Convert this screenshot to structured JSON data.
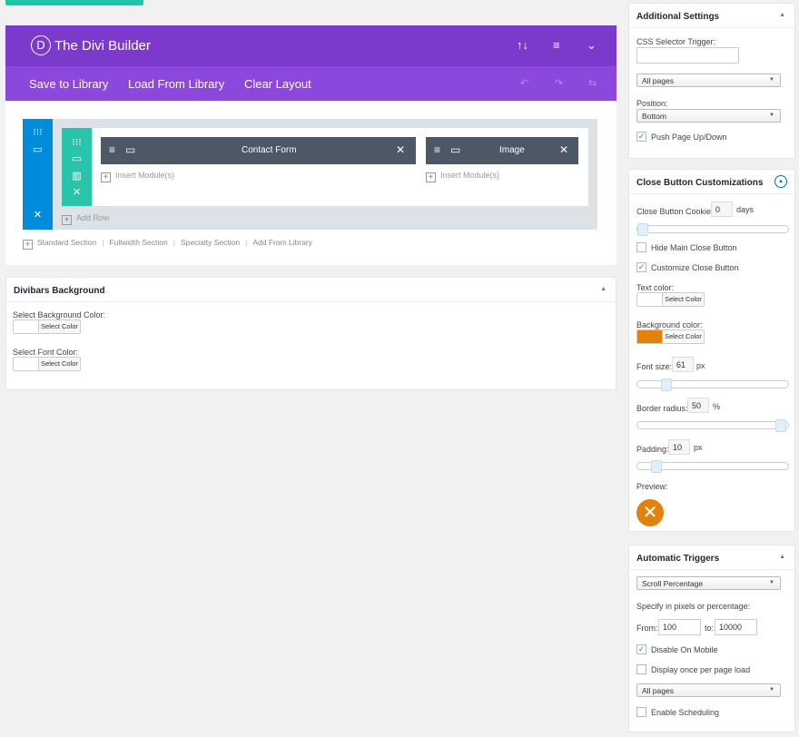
{
  "builder": {
    "logo_letter": "D",
    "title": "The Divi Builder",
    "toolbar": {
      "save": "Save to Library",
      "load": "Load From Library",
      "clear": "Clear Layout"
    },
    "modules": [
      {
        "label": "Contact Form"
      },
      {
        "label": "Image"
      }
    ],
    "insert_label": "Insert Module(s)",
    "add_row": "Add Row",
    "section_links": [
      "Standard Section",
      "Fullwidth Section",
      "Specialty Section",
      "Add From Library"
    ]
  },
  "background_panel": {
    "title": "Divibars Background",
    "bg_label": "Select Background Color:",
    "font_label": "Select Font Color:",
    "select_color": "Select Color"
  },
  "additional": {
    "title": "Additional Settings",
    "css_label": "CSS Selector Trigger:",
    "css_value": "",
    "pages": "All pages",
    "position_label": "Position:",
    "position": "Bottom",
    "push_label": "Push Page Up/Down",
    "push_checked": true
  },
  "close_button": {
    "title": "Close Button Customizations",
    "cookie_label": "Close Button Cookie:",
    "cookie_value": "0",
    "cookie_unit": "days",
    "hide_label": "Hide Main Close Button",
    "hide_checked": false,
    "customize_label": "Customize Close Button",
    "customize_checked": true,
    "text_color_label": "Text color:",
    "bg_color_label": "Background color:",
    "bg_color": "#e0820d",
    "select_color": "Select Color",
    "font_size_label": "Font size:",
    "font_size": "61",
    "font_size_unit": "px",
    "border_radius_label": "Border radius:",
    "border_radius": "50",
    "border_radius_unit": "%",
    "padding_label": "Padding:",
    "padding": "10",
    "padding_unit": "px",
    "preview_label": "Preview:",
    "cookie_slider_level": 0,
    "font_slider_level": 0.17,
    "radius_slider_level": 1.0,
    "padding_slider_level": 0.1
  },
  "triggers": {
    "title": "Automatic Triggers",
    "trigger_type": "Scroll Percentage",
    "specify_label": "Specify in pixels or percentage:",
    "from_label": "From:",
    "from_value": "100",
    "to_label": "to:",
    "to_value": "10000",
    "disable_mobile_label": "Disable On Mobile",
    "disable_mobile_checked": true,
    "once_label": "Display once per page load",
    "once_checked": false,
    "pages": "All pages",
    "scheduling_label": "Enable Scheduling",
    "scheduling_checked": false
  },
  "colors": {
    "purple_header": "#7c3acd",
    "purple_toolbar": "#8c47dc",
    "section_blue": "#008bdb",
    "row_teal": "#29c4a9",
    "module_dark": "#4c5866",
    "preview_orange": "#e0820d"
  }
}
